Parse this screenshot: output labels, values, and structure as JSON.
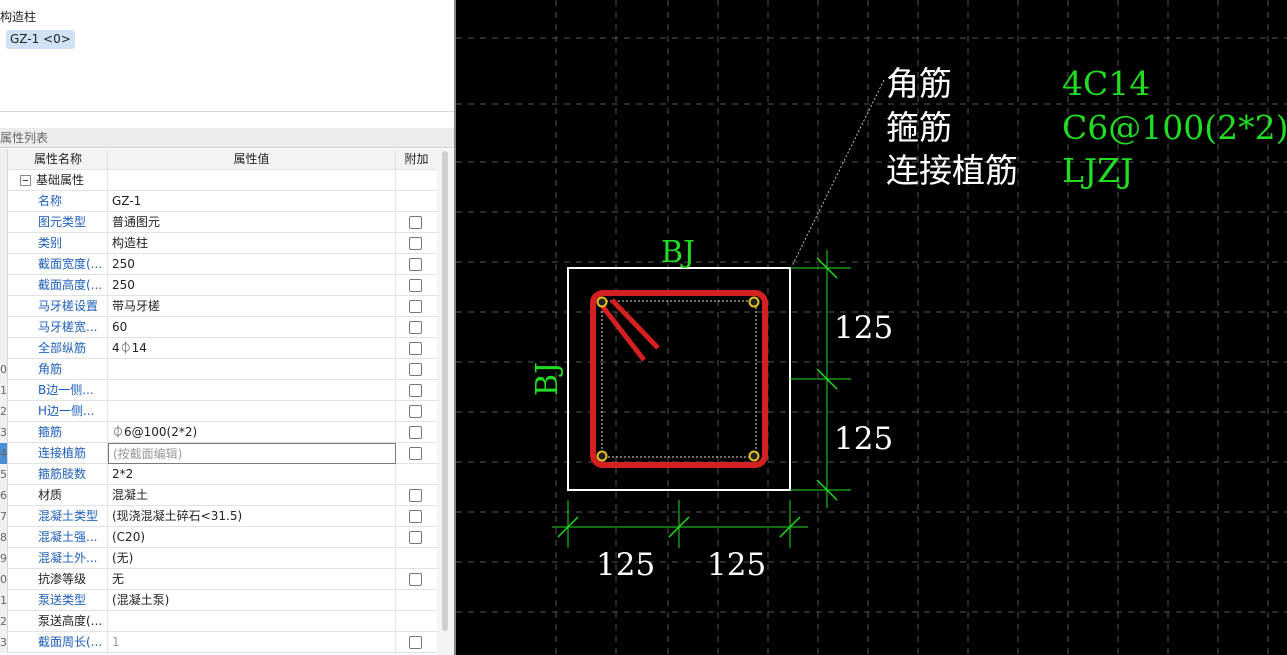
{
  "tree": {
    "root": "构造柱",
    "item": "GZ-1 <0>"
  },
  "panel": {
    "title": "属性列表"
  },
  "grid": {
    "headers": {
      "name": "属性名称",
      "value": "属性值",
      "add": "附加"
    },
    "rows": [
      {
        "num": "",
        "name": "基础属性",
        "value": "",
        "group": true,
        "checkbox": false
      },
      {
        "num": "",
        "name": "名称",
        "value": "GZ-1",
        "checkbox": false
      },
      {
        "num": "",
        "name": "图元类型",
        "value": "普通图元",
        "checkbox": true
      },
      {
        "num": "",
        "name": "类别",
        "value": "构造柱",
        "checkbox": true
      },
      {
        "num": "",
        "name": "截面宽度(...",
        "value": "250",
        "checkbox": true
      },
      {
        "num": "",
        "name": "截面高度(...",
        "value": "250",
        "checkbox": true
      },
      {
        "num": "",
        "name": "马牙槎设置",
        "value": "带马牙槎",
        "checkbox": true
      },
      {
        "num": "",
        "name": "马牙槎宽...",
        "value": "60",
        "checkbox": true
      },
      {
        "num": "",
        "name": "全部纵筋",
        "value": "4⏀14",
        "checkbox": true
      },
      {
        "num": "0",
        "name": "角筋",
        "value": "",
        "checkbox": true
      },
      {
        "num": "1",
        "name": "B边一侧...",
        "value": "",
        "checkbox": true
      },
      {
        "num": "2",
        "name": "H边一侧...",
        "value": "",
        "checkbox": true
      },
      {
        "num": "3",
        "name": "箍筋",
        "value": "⏀6@100(2*2)",
        "checkbox": true
      },
      {
        "num": "4",
        "name": "连接植筋",
        "value": "(按截面编辑)",
        "checkbox": true,
        "selected": true
      },
      {
        "num": "5",
        "name": "箍筋肢数",
        "value": "2*2",
        "checkbox": false
      },
      {
        "num": "6",
        "name": "材质",
        "value": "混凝土",
        "checkbox": true,
        "black": true
      },
      {
        "num": "7",
        "name": "混凝土类型",
        "value": "(现浇混凝土碎石<31.5)",
        "checkbox": true
      },
      {
        "num": "8",
        "name": "混凝土强...",
        "value": "(C20)",
        "checkbox": true
      },
      {
        "num": "9",
        "name": "混凝土外...",
        "value": "(无)",
        "checkbox": false
      },
      {
        "num": "0",
        "name": "抗渗等级",
        "value": "无",
        "checkbox": true,
        "black": true
      },
      {
        "num": "1",
        "name": "泵送类型",
        "value": "(混凝土泵)",
        "checkbox": false
      },
      {
        "num": "2",
        "name": "泵送高度(...",
        "value": "",
        "checkbox": false,
        "black": true
      },
      {
        "num": "3",
        "name": "截面周长(...",
        "value": "1",
        "checkbox": true,
        "gray": true
      }
    ]
  },
  "cad": {
    "legend": [
      {
        "label": "角筋",
        "value": "4C14"
      },
      {
        "label": "箍筋",
        "value": "C6@100(2*2)"
      },
      {
        "label": "连接植筋",
        "value": "LJZJ"
      }
    ],
    "side_label_top": "BJ",
    "side_label_left": "BJ",
    "dim_right": [
      "125",
      "125"
    ],
    "dim_bottom": [
      "125",
      "125"
    ],
    "colors": {
      "label": "#ffffff",
      "value": "#22dd22",
      "stirrup": "#d42020",
      "bar": "#e8c020",
      "dim": "#22dd22"
    }
  }
}
